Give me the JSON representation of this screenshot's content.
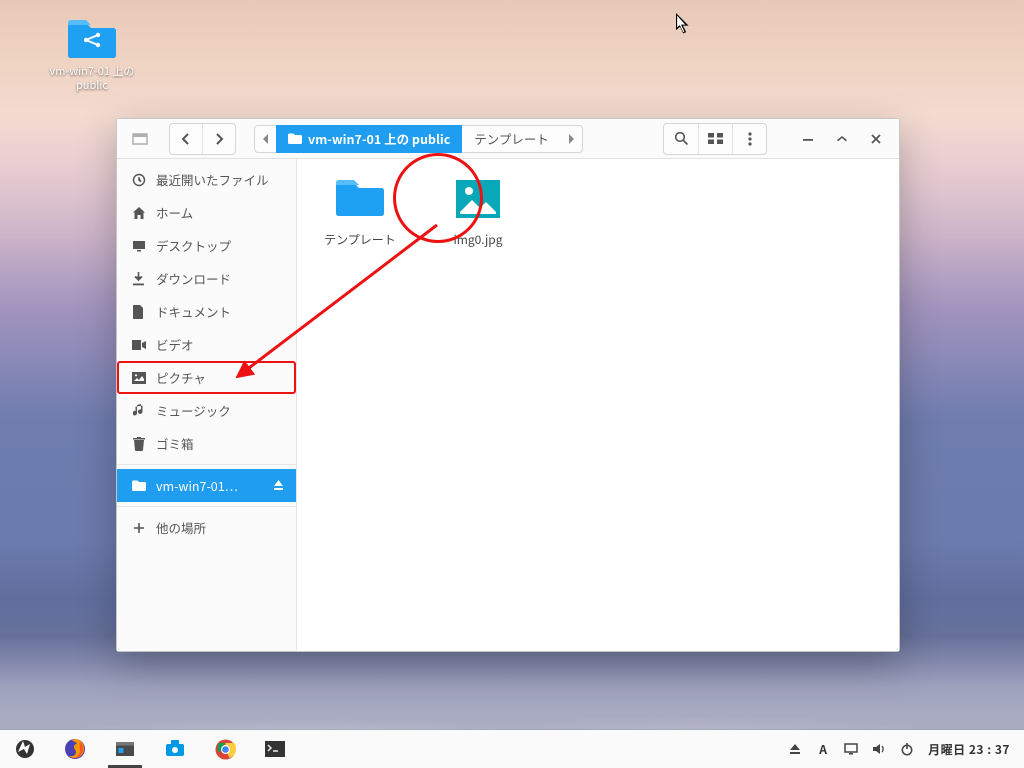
{
  "desktop": {
    "icon_label": "vm-win7-01 上の public"
  },
  "window": {
    "path": {
      "current": "vm-win7-01 上の public",
      "next": "テンプレート"
    },
    "sidebar": {
      "items": [
        {
          "id": "recent",
          "label": "最近開いたファイル"
        },
        {
          "id": "home",
          "label": "ホーム"
        },
        {
          "id": "desktop",
          "label": "デスクトップ"
        },
        {
          "id": "downloads",
          "label": "ダウンロード"
        },
        {
          "id": "documents",
          "label": "ドキュメント"
        },
        {
          "id": "videos",
          "label": "ビデオ"
        },
        {
          "id": "pictures",
          "label": "ピクチャ"
        },
        {
          "id": "music",
          "label": "ミュージック"
        },
        {
          "id": "trash",
          "label": "ゴミ箱"
        }
      ],
      "mounted": {
        "label": "vm-win7-01…"
      },
      "other": {
        "label": "他の場所"
      }
    },
    "files": [
      {
        "id": "templates",
        "name": "テンプレート",
        "type": "folder"
      },
      {
        "id": "img0",
        "name": "img0.jpg",
        "type": "image"
      }
    ]
  },
  "taskbar": {
    "clock": "月曜日 23 : 37",
    "lang": "A"
  }
}
